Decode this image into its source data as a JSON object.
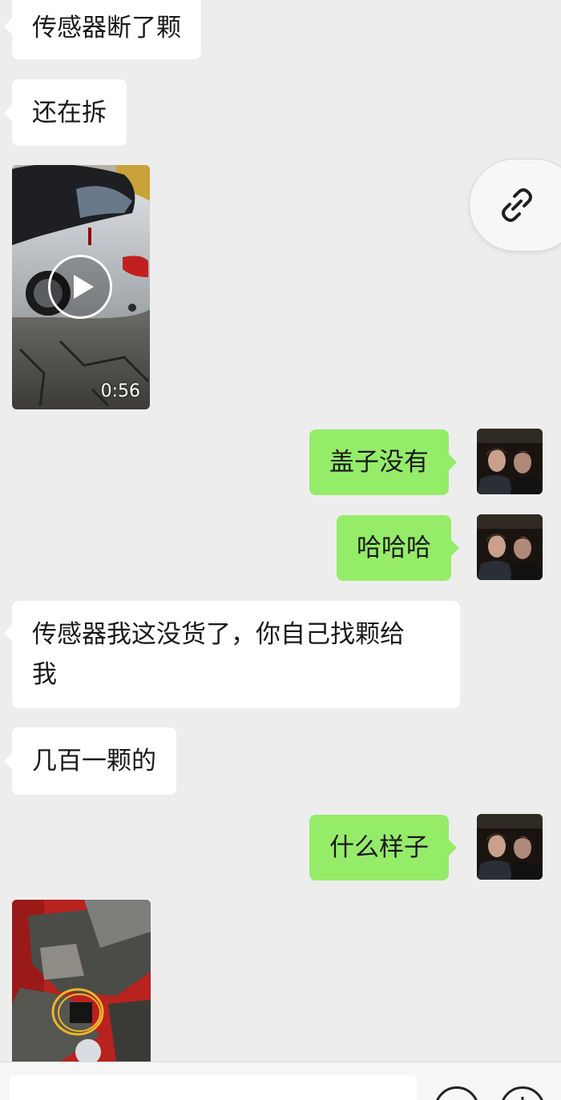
{
  "messages": [
    {
      "side": "in",
      "type": "text",
      "text": "传感器断了颗"
    },
    {
      "side": "in",
      "type": "text",
      "text": "还在拆"
    },
    {
      "side": "in",
      "type": "video",
      "duration": "0:56"
    },
    {
      "side": "out",
      "type": "text",
      "text": "盖子没有"
    },
    {
      "side": "out",
      "type": "text",
      "text": "哈哈哈"
    },
    {
      "side": "in",
      "type": "text",
      "line1": "传感器我这没货了，你自己找颗给",
      "line2": "我"
    },
    {
      "side": "in",
      "type": "text",
      "text": "几百一颗的"
    },
    {
      "side": "out",
      "type": "text",
      "text": "什么样子"
    },
    {
      "side": "in",
      "type": "image"
    }
  ],
  "colors": {
    "background": "#ededed",
    "incoming_bubble": "#ffffff",
    "outgoing_bubble": "#95ec69"
  },
  "icons": {
    "floating": "link-icon",
    "video_overlay": "play-icon",
    "input_left": "emoji-icon",
    "input_right": "plus-icon"
  }
}
